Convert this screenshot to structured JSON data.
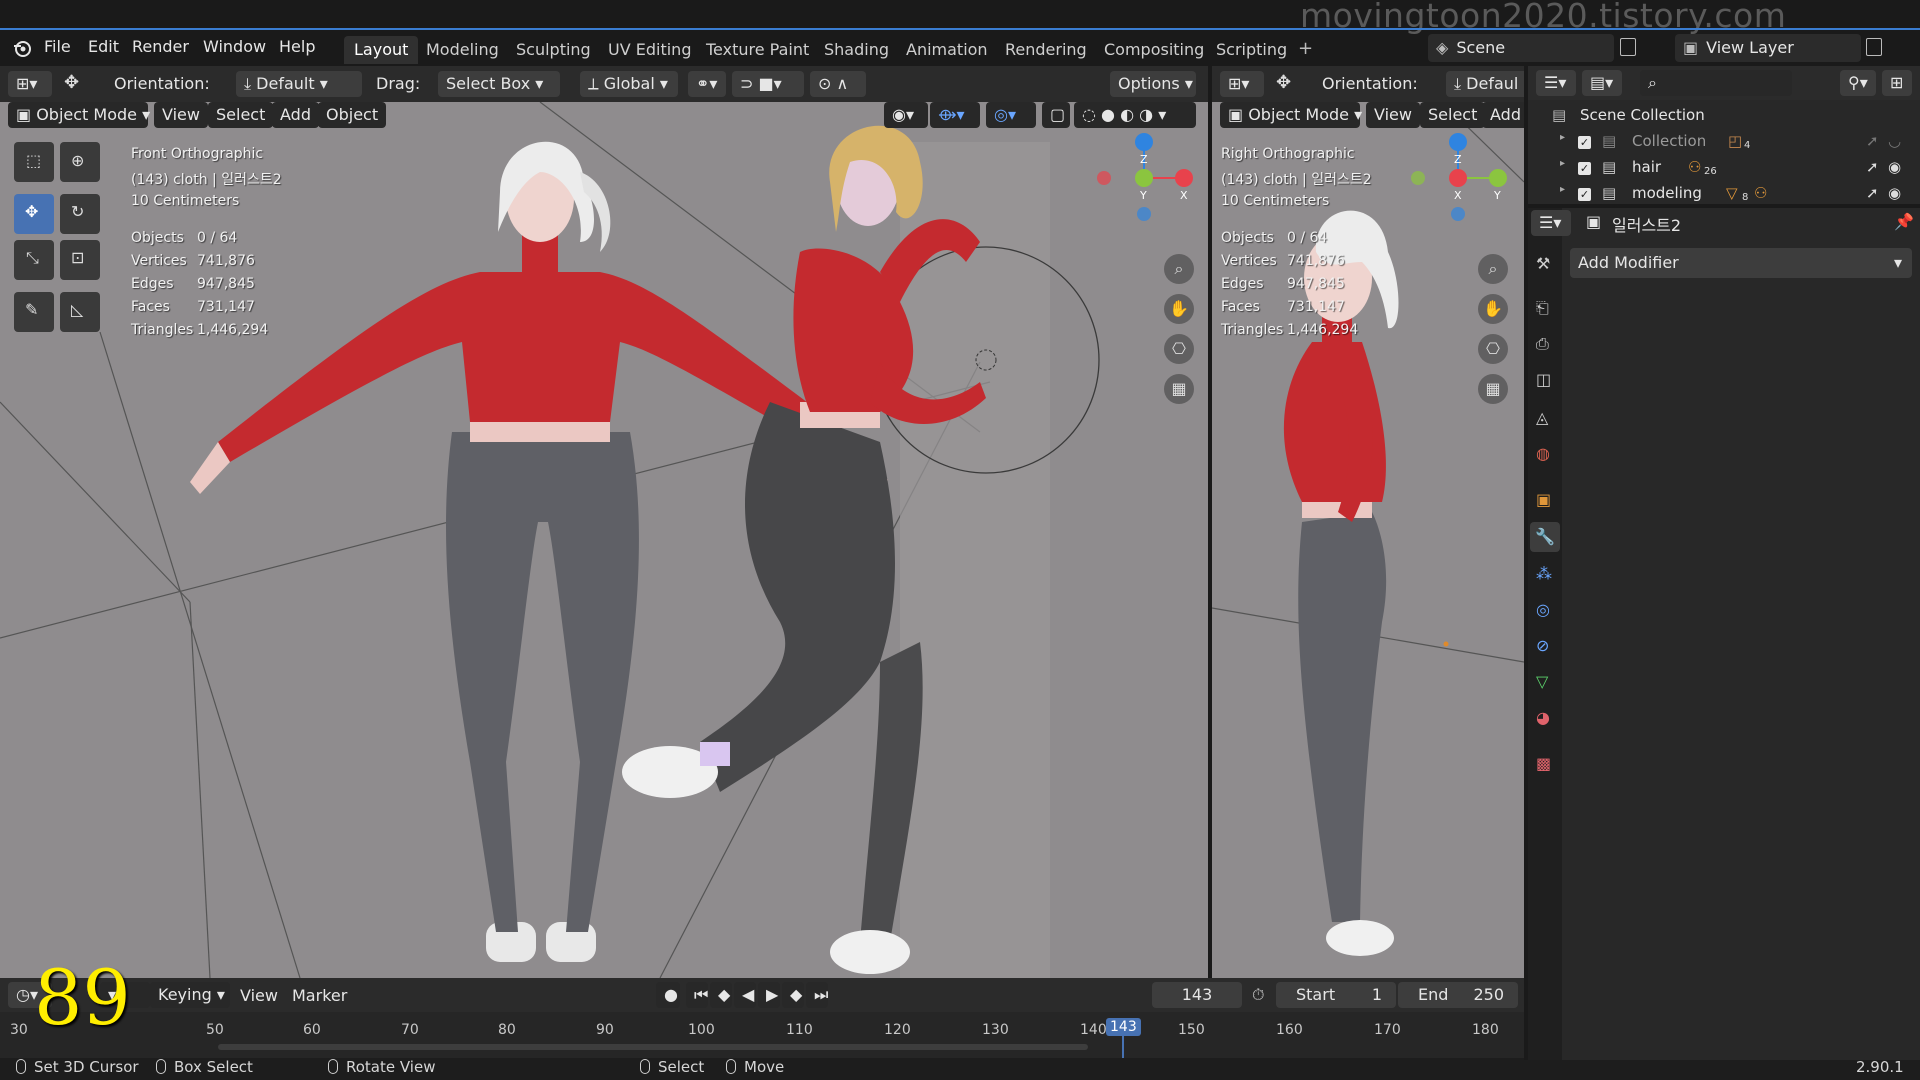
{
  "watermark": "movingtoon2020.tistory.com",
  "menu": [
    "File",
    "Edit",
    "Render",
    "Window",
    "Help"
  ],
  "workspaces": [
    "Layout",
    "Modeling",
    "Sculpting",
    "UV Editing",
    "Texture Paint",
    "Shading",
    "Animation",
    "Rendering",
    "Compositing",
    "Scripting"
  ],
  "active_workspace": "Layout",
  "scene": "Scene",
  "view_layer": "View Layer",
  "header": {
    "orientation_label": "Orientation:",
    "orientation_value": "Default",
    "drag_label": "Drag:",
    "drag_value": "Select Box",
    "transform": "Global",
    "options": "Options"
  },
  "viewport_header": {
    "mode": "Object Mode",
    "view": "View",
    "select": "Select",
    "add": "Add",
    "object": "Object"
  },
  "left_view": {
    "title": "Front Orthographic",
    "subtitle": "(143) cloth | 일러스트2",
    "scale": "10 Centimeters",
    "stats": [
      {
        "k": "Objects",
        "v": "0 / 64"
      },
      {
        "k": "Vertices",
        "v": "741,876"
      },
      {
        "k": "Edges",
        "v": "947,845"
      },
      {
        "k": "Faces",
        "v": "731,147"
      },
      {
        "k": "Triangles",
        "v": "1,446,294"
      }
    ]
  },
  "right_view": {
    "orientation_label": "Orientation:",
    "orientation_value": "Defaul",
    "mode": "Object Mode",
    "view": "View",
    "select": "Select",
    "add": "Add",
    "title": "Right Orthographic",
    "subtitle": "(143) cloth | 일러스트2",
    "scale": "10 Centimeters",
    "stats": [
      {
        "k": "Objects",
        "v": "0 / 64"
      },
      {
        "k": "Vertices",
        "v": "741,876"
      },
      {
        "k": "Edges",
        "v": "947,845"
      },
      {
        "k": "Faces",
        "v": "731,147"
      },
      {
        "k": "Triangles",
        "v": "1,446,294"
      }
    ]
  },
  "gizmo_axes": {
    "z": "Z",
    "y": "Y",
    "x": "X"
  },
  "outliner": {
    "root": "Scene Collection",
    "items": [
      {
        "name": "Collection",
        "badge": "4"
      },
      {
        "name": "hair",
        "badge": "26"
      },
      {
        "name": "modeling",
        "badge": "8"
      }
    ]
  },
  "properties": {
    "object_name": "일러스트2",
    "add_modifier": "Add Modifier"
  },
  "timeline": {
    "keying": "Keying",
    "view": "View",
    "marker": "Marker",
    "current_frame": "143",
    "start_label": "Start",
    "start": "1",
    "end_label": "End",
    "end": "250",
    "ruler": [
      "30",
      "50",
      "60",
      "70",
      "80",
      "90",
      "100",
      "110",
      "120",
      "130",
      "140",
      "150",
      "160",
      "170",
      "180"
    ],
    "playhead": "143"
  },
  "overlay_number": "89",
  "statusbar": {
    "set_cursor": "Set 3D Cursor",
    "box_select": "Box Select",
    "rotate_view": "Rotate View",
    "select": "Select",
    "move": "Move",
    "version": "2.90.1"
  },
  "colors": {
    "accent": "#4772b3",
    "sweater": "#c42a2f",
    "pants": "#5f6066",
    "viewport_bg": "#8f8c8e",
    "axis_x": "#e8424c",
    "axis_y": "#8bc53f",
    "axis_z": "#2f84e0"
  }
}
